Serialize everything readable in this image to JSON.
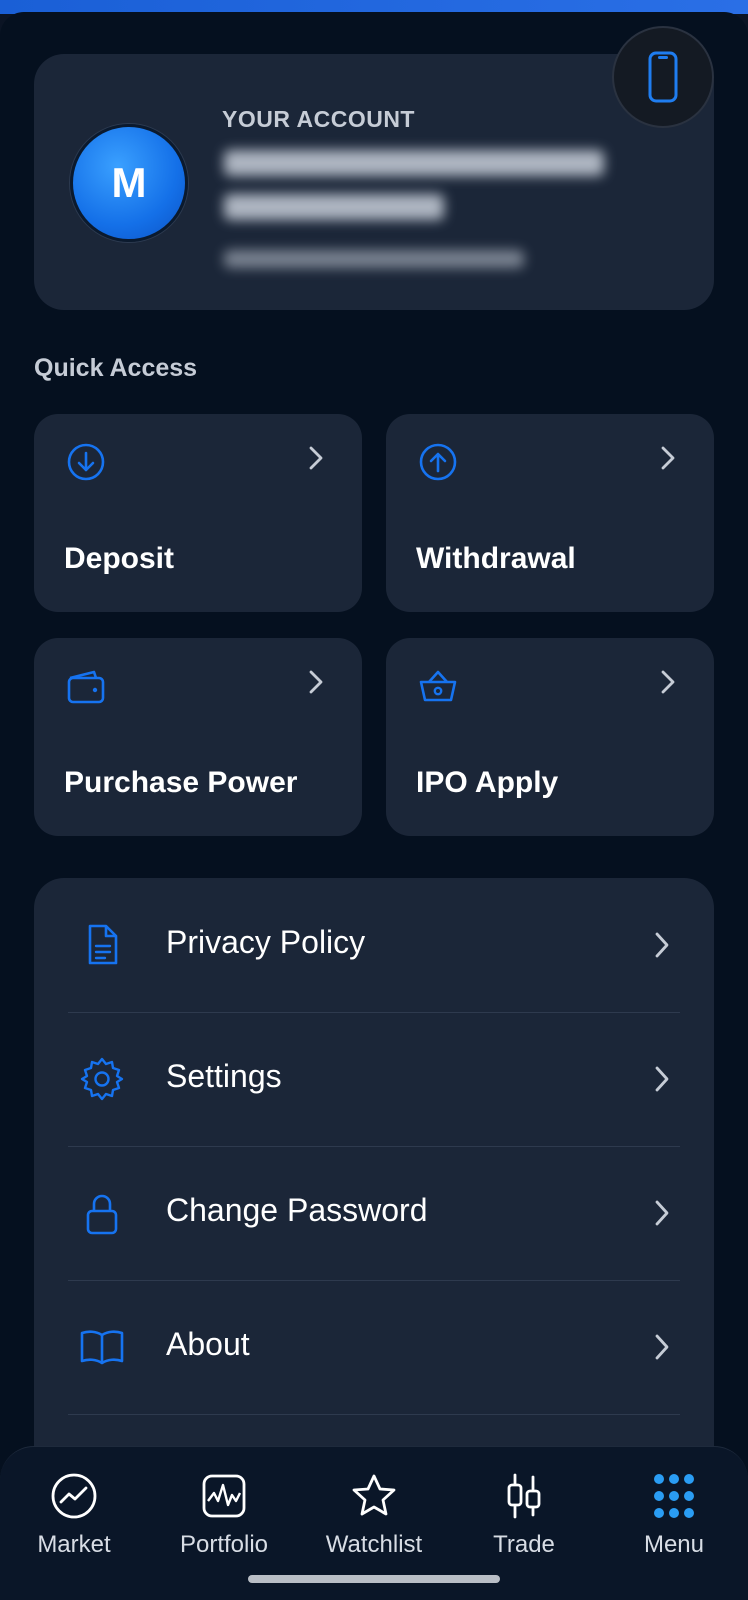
{
  "account": {
    "label": "YOUR ACCOUNT",
    "avatar_initial": "M"
  },
  "quick_access": {
    "title": "Quick Access",
    "items": [
      {
        "label": "Deposit",
        "icon": "arrow-down-circle-icon"
      },
      {
        "label": "Withdrawal",
        "icon": "arrow-up-circle-icon"
      },
      {
        "label": "Purchase Power",
        "icon": "wallet-icon"
      },
      {
        "label": "IPO Apply",
        "icon": "basket-icon"
      }
    ]
  },
  "menu": {
    "items": [
      {
        "label": "Privacy Policy",
        "icon": "document-icon"
      },
      {
        "label": "Settings",
        "icon": "gear-icon"
      },
      {
        "label": "Change Password",
        "icon": "lock-icon"
      },
      {
        "label": "About",
        "icon": "book-icon"
      }
    ]
  },
  "bottom_nav": {
    "items": [
      {
        "label": "Market",
        "icon": "trend-circle-icon"
      },
      {
        "label": "Portfolio",
        "icon": "chart-square-icon"
      },
      {
        "label": "Watchlist",
        "icon": "star-icon"
      },
      {
        "label": "Trade",
        "icon": "candlestick-icon"
      },
      {
        "label": "Menu",
        "icon": "grid-dots-icon"
      }
    ],
    "active": "Menu"
  },
  "colors": {
    "accent": "#1673f0",
    "card": "#1b2638",
    "background": "#05101f"
  }
}
